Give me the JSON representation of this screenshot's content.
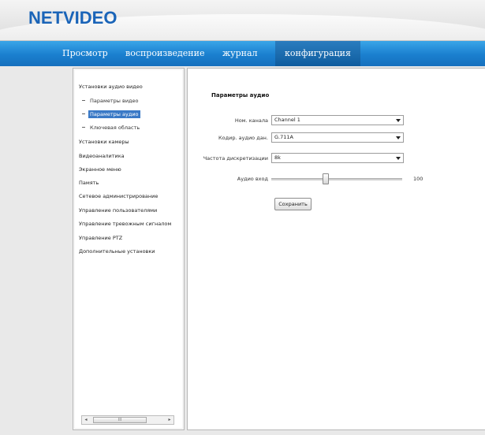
{
  "logo": "NETVIDEO",
  "nav": [
    "Просмотр",
    "воспроизведение",
    "журнал",
    "конфигурация"
  ],
  "nav_active": "конфигурация",
  "sidebar": {
    "items": [
      "Установки аудио видео",
      "Параметры видео",
      "Параметры аудио",
      "Ключевая область",
      "Установки камеры",
      "Видеоаналитика",
      "Экранное меню",
      "Память",
      "Сетевое администрирование",
      "Управление пользователями",
      "Управление тревожным сигналом",
      "Управление PTZ",
      "Дополнительные установки"
    ],
    "selected": "Параметры аудио",
    "scrollbar": {
      "left_arrow": "◂",
      "thumb_grip": "III",
      "right_arrow": "▸"
    }
  },
  "content": {
    "title": "Параметры аудио",
    "fields": {
      "channel": {
        "label": "Ном. канала",
        "value": "Channel 1"
      },
      "codec": {
        "label": "Кодир. аудио дан.",
        "value": "G.711A"
      },
      "sample_rate": {
        "label": "Частота дискретизации",
        "value": "8k"
      },
      "audio_input": {
        "label": "Аудио вход",
        "value": "100",
        "level": 0.4
      }
    },
    "save_label": "Сохранить"
  }
}
